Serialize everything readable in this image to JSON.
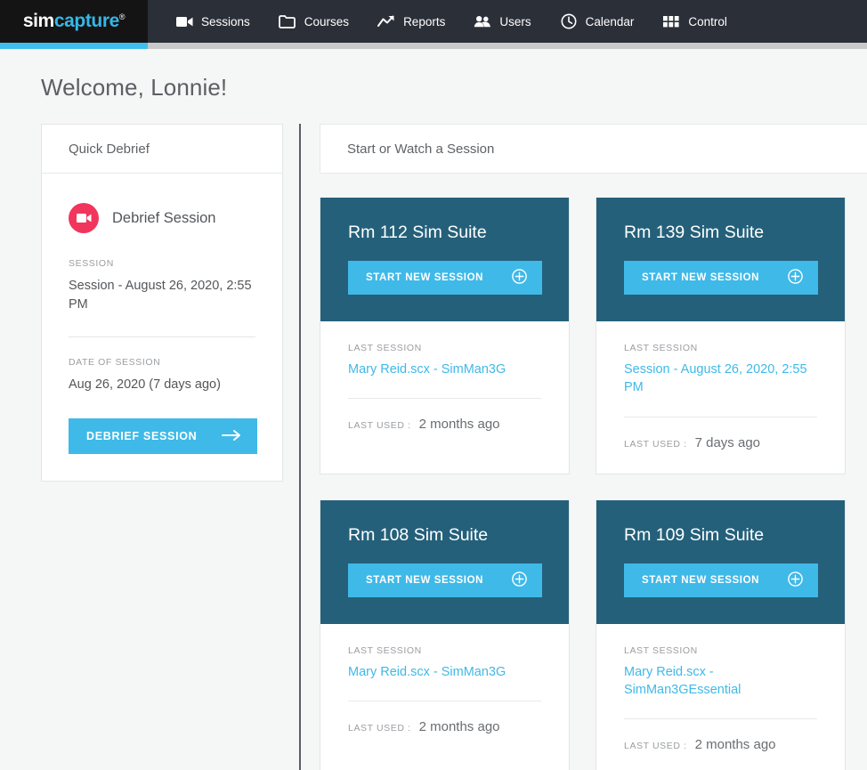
{
  "brand": {
    "logo_first": "sim",
    "logo_second": "capture",
    "logo_registered": "®",
    "accent_cyan": "#3fb9e8",
    "accent_teal": "#24607a",
    "accent_red": "#f2355c",
    "nav_background": "#2b2f38",
    "logo_background": "#141414"
  },
  "nav": {
    "items": [
      {
        "label": "Sessions",
        "icon": "video-camera-icon"
      },
      {
        "label": "Courses",
        "icon": "folder-icon"
      },
      {
        "label": "Reports",
        "icon": "trending-up-icon"
      },
      {
        "label": "Users",
        "icon": "users-icon"
      },
      {
        "label": "Calendar",
        "icon": "clock-icon"
      },
      {
        "label": "Control",
        "icon": "grid-icon"
      }
    ]
  },
  "page": {
    "welcome": "Welcome, Lonnie!"
  },
  "quick_debrief": {
    "panel_title": "Quick Debrief",
    "icon": "video-camera-icon",
    "heading": "Debrief Session",
    "session_label": "SESSION",
    "session_value": "Session - August 26, 2020, 2:55 PM",
    "date_label": "DATE OF SESSION",
    "date_value": "Aug 26, 2020 (7 days ago)",
    "button_label": "DEBRIEF SESSION",
    "button_icon": "arrow-right-icon"
  },
  "sessions_panel": {
    "title": "Start or Watch a Session",
    "start_button_label": "START NEW SESSION",
    "start_button_icon": "plus-circle-icon",
    "last_session_label": "LAST SESSION",
    "last_used_label": "LAST USED :",
    "cards": [
      {
        "room": "Rm 112 Sim Suite",
        "last_session": "Mary Reid.scx - SimMan3G",
        "last_used": "2 months ago"
      },
      {
        "room": "Rm 139 Sim Suite",
        "last_session": "Session - August 26, 2020, 2:55 PM",
        "last_used": "7 days ago"
      },
      {
        "room": "Rm 108 Sim Suite",
        "last_session": "Mary Reid.scx - SimMan3G",
        "last_used": "2 months ago"
      },
      {
        "room": "Rm 109 Sim Suite",
        "last_session": "Mary Reid.scx - SimMan3GEssential",
        "last_used": "2 months ago"
      }
    ]
  }
}
